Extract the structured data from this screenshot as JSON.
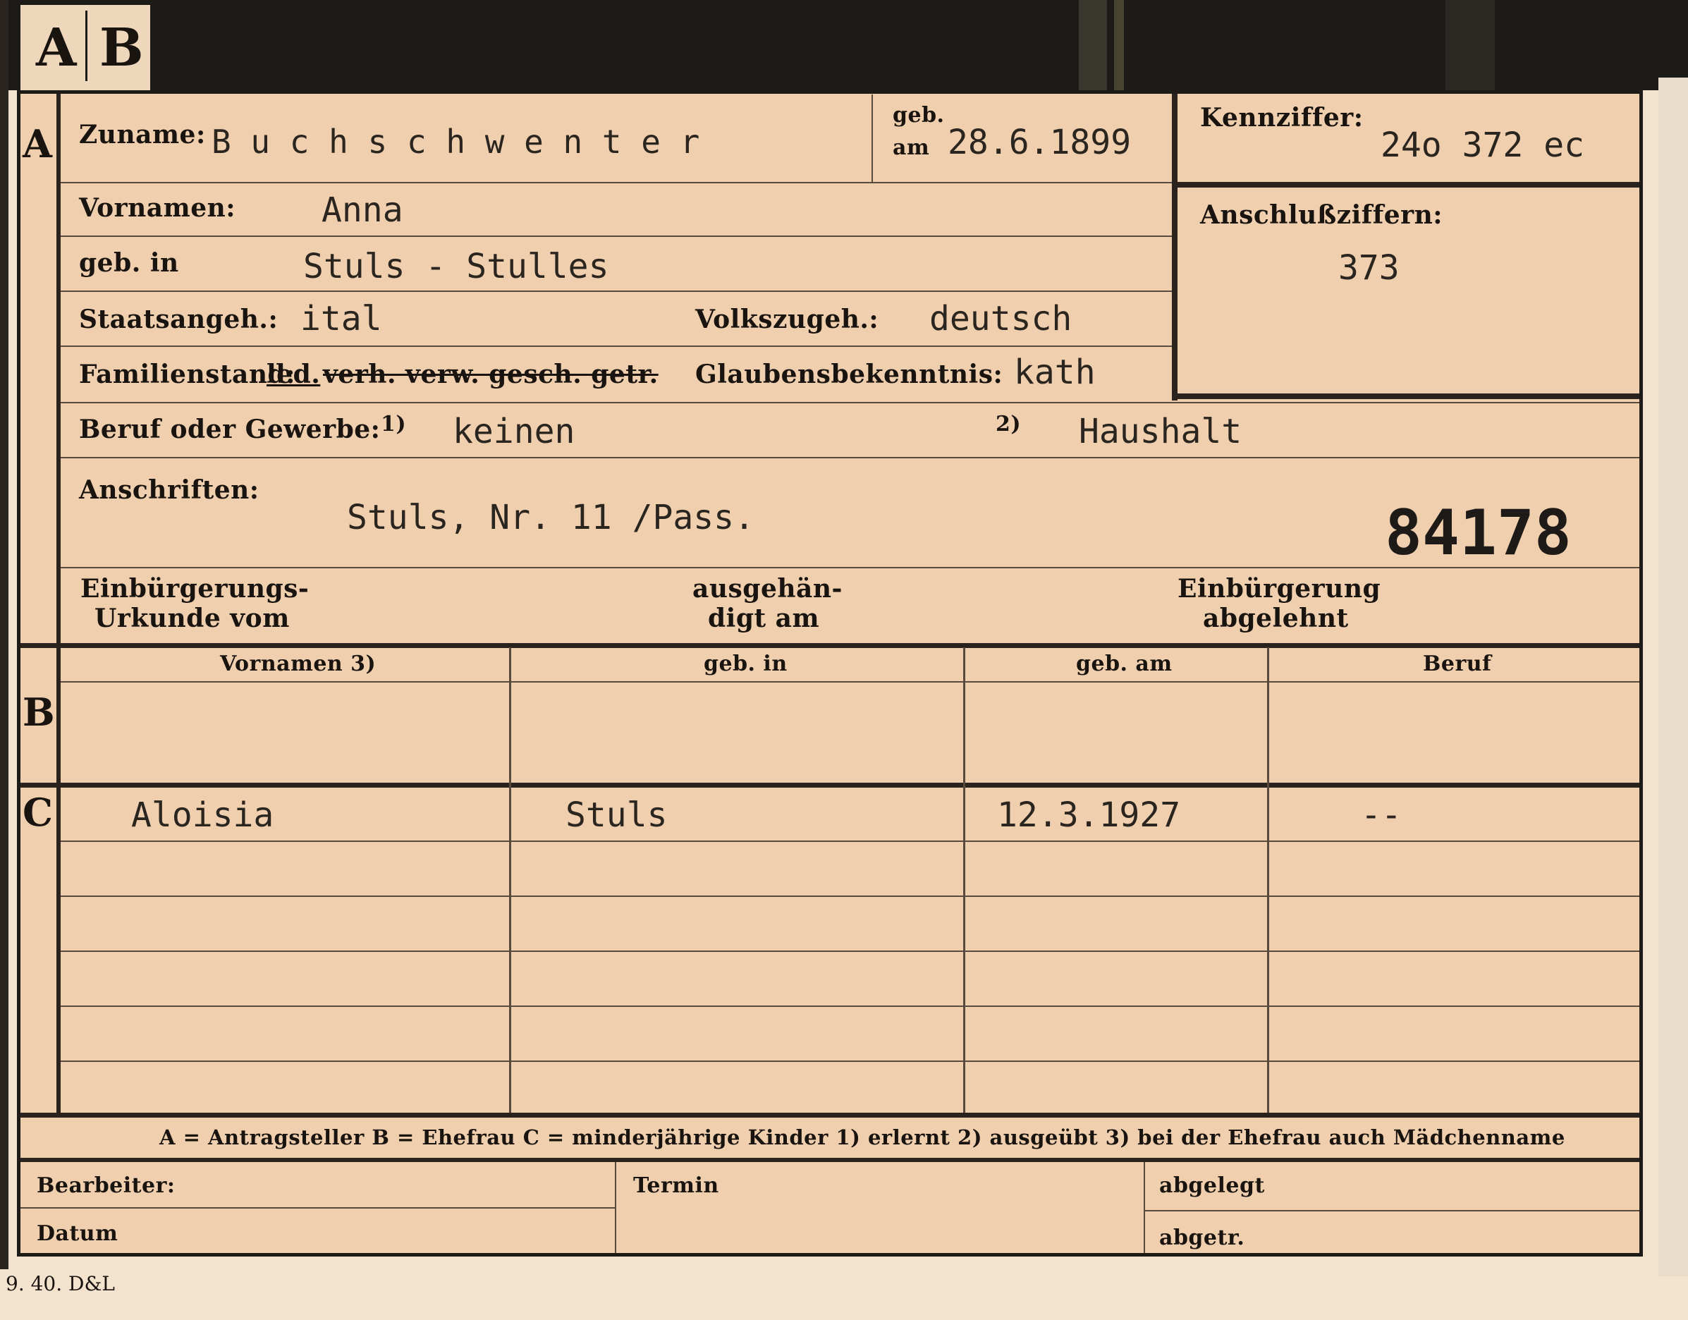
{
  "tab": {
    "a": "A",
    "b": "B"
  },
  "sections": {
    "a": "A",
    "b": "B",
    "c": "C"
  },
  "header": {
    "surname_label": "Zuname:",
    "surname": "B u c h s c h w e n t e r",
    "born_label_1": "geb.",
    "born_label_2": "am",
    "born_date": "28.6.1899",
    "id_label": "Kennziffer:",
    "id_value": "24o 372 ec",
    "ref_label": "Anschlußziffern:",
    "ref_value": "373"
  },
  "fields": {
    "given_label": "Vornamen:",
    "given": "Anna",
    "birthplace_label": "geb. in",
    "birthplace": "Stuls - Stulles",
    "citizenship_label": "Staatsangeh.:",
    "citizenship": "ital",
    "ethnicity_label": "Volkszugeh.:",
    "ethnicity": "deutsch",
    "marital_label": "Familienstand:",
    "marital_selected": "led.",
    "marital_struck": "verh. verw. gesch. getr.",
    "religion_label": "Glaubensbekenntnis:",
    "religion": "kath",
    "occupation_label": "Beruf oder Gewerbe:",
    "occ_note1": "1)",
    "occupation_learned": "keinen",
    "occ_note2": "2)",
    "occupation_practiced": "Haushalt",
    "address_label": "Anschriften:",
    "address": "Stuls, Nr. 11 /Pass.",
    "stamp_number": "84178",
    "natur_cert_label_1": "Einbürgerungs-",
    "natur_cert_label_2": "Urkunde vom",
    "handed_label_1": "ausgehän-",
    "handed_label_2": "digt am",
    "natur_denied_label_1": "Einbürgerung",
    "natur_denied_label_2": "abgelehnt"
  },
  "table": {
    "headers": [
      "Vornamen 3)",
      "geb. in",
      "geb. am",
      "Beruf"
    ],
    "child": {
      "name": "Aloisia",
      "place": "Stuls",
      "date": "12.3.1927",
      "job": "--"
    }
  },
  "legend": "A = Antragsteller   B = Ehefrau   C = minderjährige Kinder   1) erlernt   2) ausgeübt   3) bei der Ehefrau auch Mädchenname",
  "bottom": {
    "clerk": "Bearbeiter:",
    "date": "Datum",
    "term": "Termin",
    "filed": "abgelegt",
    "removed": "abgetr."
  },
  "print_code": "9. 40. D&L"
}
